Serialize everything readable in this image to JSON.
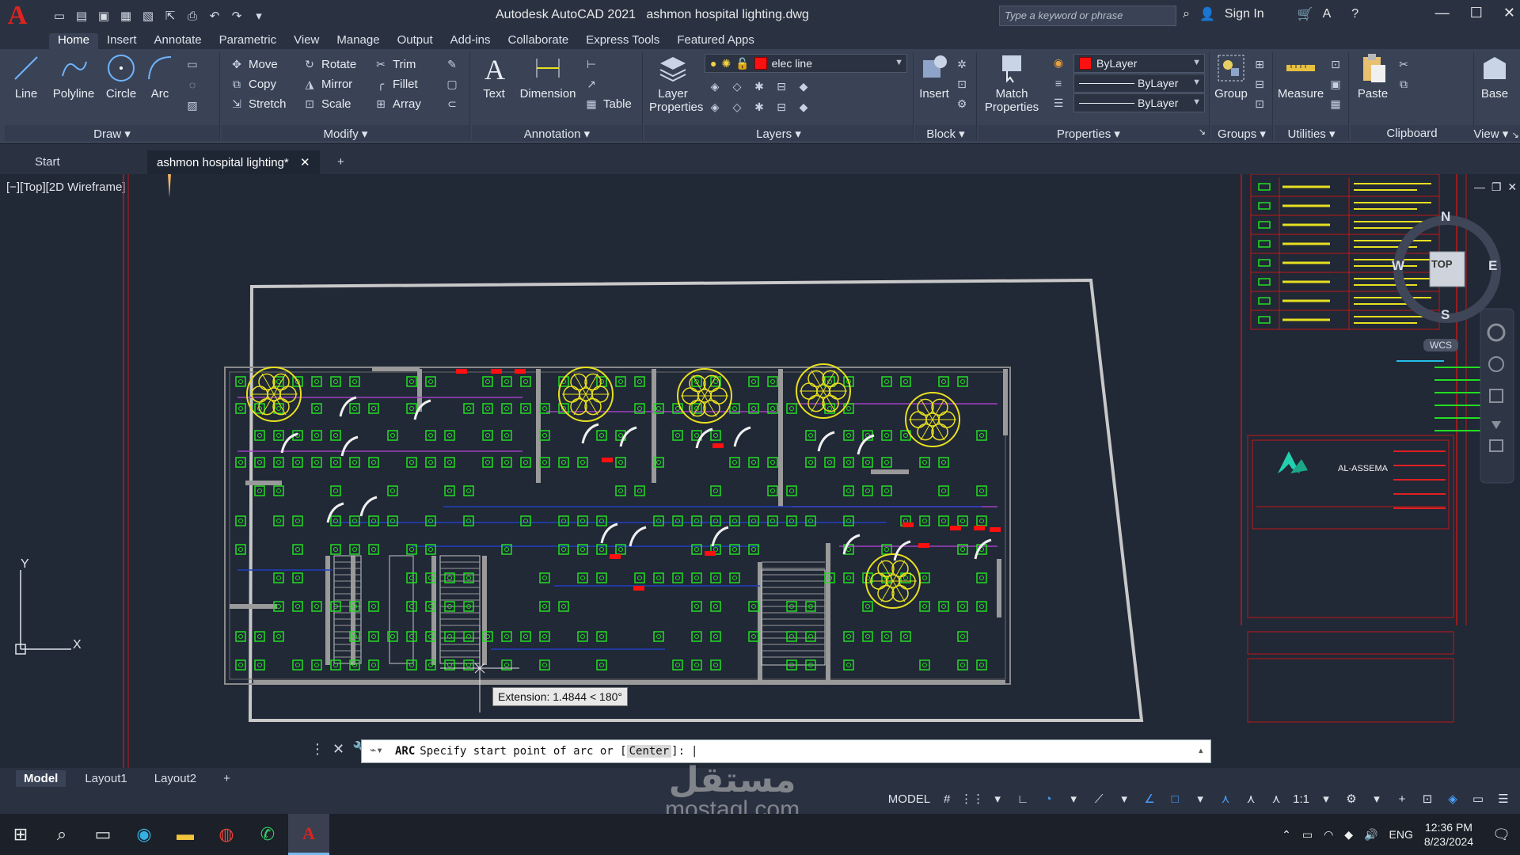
{
  "app": {
    "name": "Autodesk AutoCAD 2021",
    "document": "ashmon hospital lighting.dwg",
    "search_placeholder": "Type a keyword or phrase",
    "sign_in": "Sign In"
  },
  "menu_tabs": [
    "Home",
    "Insert",
    "Annotate",
    "Parametric",
    "View",
    "Manage",
    "Output",
    "Add-ins",
    "Collaborate",
    "Express Tools",
    "Featured Apps"
  ],
  "ribbon": {
    "draw": {
      "title": "Draw",
      "line": "Line",
      "polyline": "Polyline",
      "circle": "Circle",
      "arc": "Arc"
    },
    "modify": {
      "title": "Modify",
      "move": "Move",
      "rotate": "Rotate",
      "trim": "Trim",
      "copy": "Copy",
      "mirror": "Mirror",
      "fillet": "Fillet",
      "stretch": "Stretch",
      "scale": "Scale",
      "array": "Array"
    },
    "annotation": {
      "title": "Annotation",
      "text": "Text",
      "dimension": "Dimension",
      "table": "Table"
    },
    "layers": {
      "title": "Layers",
      "layer_properties": "Layer Properties",
      "current_layer": "elec line"
    },
    "block": {
      "title": "Block",
      "insert": "Insert"
    },
    "properties": {
      "title": "Properties",
      "match_properties": "Match Properties",
      "color": "ByLayer",
      "linetype": "ByLayer",
      "lineweight": "ByLayer"
    },
    "groups": {
      "title": "Groups",
      "group": "Group"
    },
    "utilities": {
      "title": "Utilities",
      "measure": "Measure"
    },
    "clipboard": {
      "title": "Clipboard",
      "paste": "Paste"
    },
    "view": {
      "title": "View",
      "base": "Base"
    }
  },
  "doc_tabs": {
    "start": "Start",
    "active": "ashmon hospital lighting*"
  },
  "viewport": {
    "label": "[−][Top][2D Wireframe]",
    "viewcube": {
      "top": "TOP",
      "north": "N",
      "south": "S",
      "east": "E",
      "west": "W",
      "wcs": "WCS"
    },
    "ucs": {
      "x": "X",
      "y": "Y"
    },
    "tooltip": "Extension: 1.4844 < 180°",
    "titleblock_company": "AL-ASSEMA"
  },
  "command": {
    "key": "ARC",
    "prompt": "Specify start point of arc or [",
    "option": "Center",
    "suffix": "]:"
  },
  "layout_tabs": [
    "Model",
    "Layout1",
    "Layout2"
  ],
  "status": {
    "model": "MODEL",
    "scale": "1:1"
  },
  "taskbar": {
    "lang": "ENG",
    "time": "12:36 PM",
    "date": "8/23/2024"
  },
  "watermark": {
    "arabic": "مستقل",
    "latin": "mostaql.com"
  },
  "colors": {
    "accent_red": "#e0231e",
    "drawing_green": "#22dd22",
    "drawing_yellow": "#e8e020",
    "boundary_gray": "#c8c8c8"
  }
}
